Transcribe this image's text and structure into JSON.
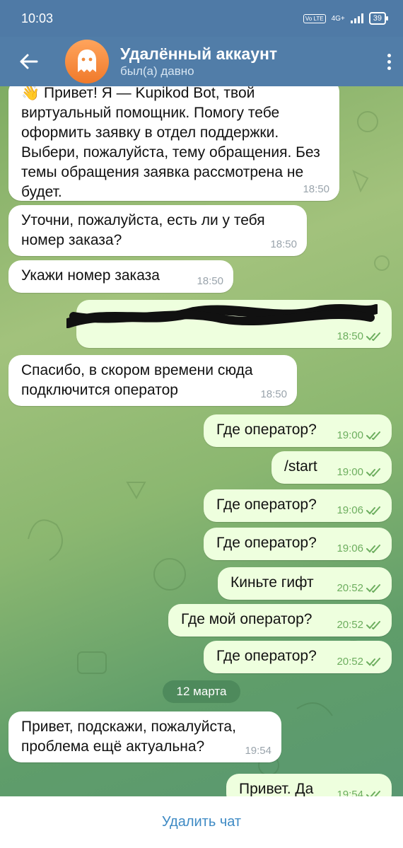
{
  "status": {
    "time": "10:03",
    "network": "4G+",
    "volte": "Vo LTE",
    "battery": "39"
  },
  "header": {
    "title": "Удалённый аккаунт",
    "subtitle": "был(а) давно"
  },
  "messages": [
    {
      "dir": "in",
      "text": "👋 Привет! Я — Kupikod Bot, твой виртуальный помощник. Помогу тебе оформить заявку в отдел поддержки. Выбери, пожалуйста, тему обращения. Без темы обращения заявка рассмотрена не будет.",
      "time": "18:50"
    },
    {
      "dir": "in",
      "text": "Уточни, пожалуйста, есть ли у тебя номер заказа?",
      "time": "18:50"
    },
    {
      "dir": "in",
      "text": "Укажи номер заказа",
      "time": "18:50"
    },
    {
      "dir": "out",
      "text": "",
      "time": "18:50"
    },
    {
      "dir": "in",
      "text": "Спасибо, в скором времени сюда подключится оператор",
      "time": "18:50"
    },
    {
      "dir": "out",
      "text": "Где оператор?",
      "time": "19:00"
    },
    {
      "dir": "out",
      "text": "/start",
      "time": "19:00"
    },
    {
      "dir": "out",
      "text": "Где оператор?",
      "time": "19:06"
    },
    {
      "dir": "out",
      "text": "Где оператор?",
      "time": "19:06"
    },
    {
      "dir": "out",
      "text": "Киньте гифт",
      "time": "20:52"
    },
    {
      "dir": "out",
      "text": "Где мой оператор?",
      "time": "20:52"
    },
    {
      "dir": "out",
      "text": "Где оператор?",
      "time": "20:52"
    },
    {
      "dir": "in",
      "text": "Привет, подскажи, пожалуйста, проблема ещё актуальна?",
      "time": "19:54"
    },
    {
      "dir": "out",
      "text": "Привет. Да",
      "time": "19:54"
    }
  ],
  "date_separator": "12 марта",
  "footer": {
    "delete_label": "Удалить чат"
  },
  "colors": {
    "header": "#517da8",
    "incoming": "#ffffff",
    "outgoing": "#eeffde",
    "accent": "#3e8ac4"
  }
}
